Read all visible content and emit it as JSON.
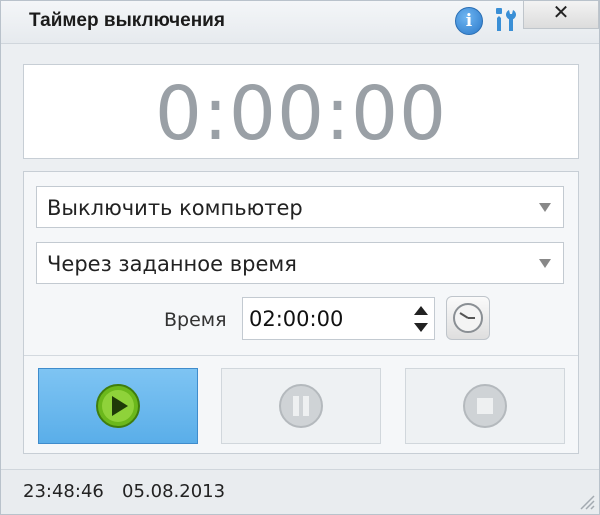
{
  "window": {
    "title": "Таймер выключения",
    "close_label": "✕"
  },
  "timer": {
    "display": "0:00:00"
  },
  "action_select": {
    "value": "Выключить компьютер"
  },
  "mode_select": {
    "value": "Через заданное время"
  },
  "time": {
    "label": "Время",
    "value": "02:00:00"
  },
  "buttons": {
    "start_icon": "play-icon",
    "pause_icon": "pause-icon",
    "stop_icon": "stop-icon"
  },
  "status": {
    "time": "23:48:46",
    "date": "05.08.2013"
  },
  "colors": {
    "accent": "#5aaee9",
    "play": "#7cc520"
  }
}
